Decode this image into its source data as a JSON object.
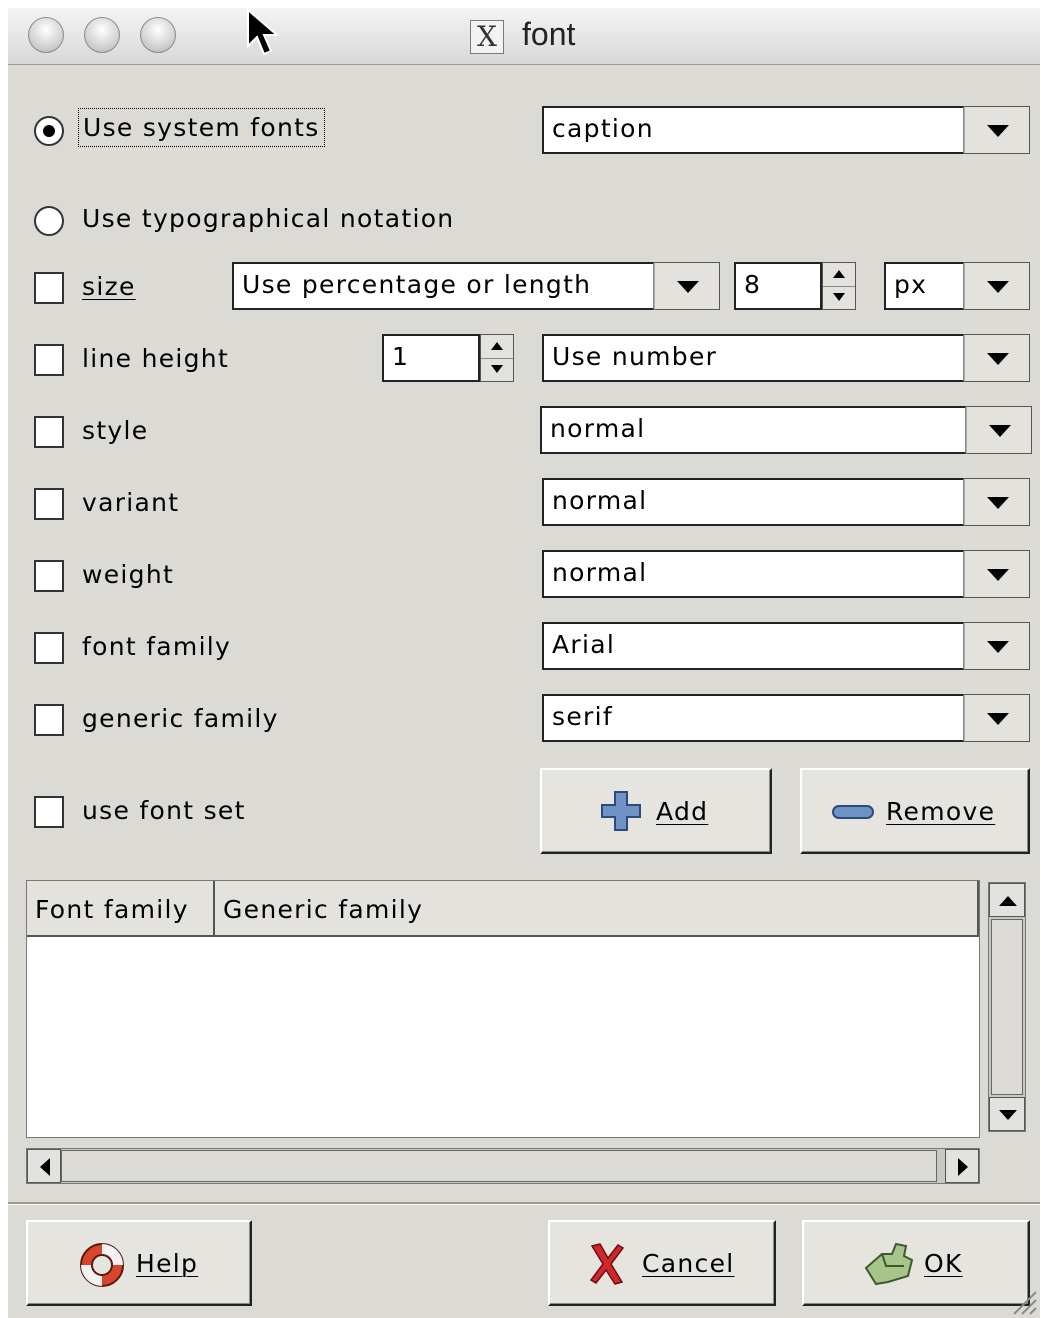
{
  "window": {
    "title": "font"
  },
  "system_fonts": {
    "label": "Use system fonts",
    "selected": true,
    "value": "caption"
  },
  "typographical": {
    "label": "Use typographical notation",
    "selected": false
  },
  "size": {
    "label": "size",
    "mode": "Use percentage or length",
    "value": "8",
    "unit": "px"
  },
  "line_height": {
    "label": "line height",
    "value": "1",
    "mode": "Use number"
  },
  "style": {
    "label": "style",
    "value": "normal"
  },
  "variant": {
    "label": "variant",
    "value": "normal"
  },
  "weight": {
    "label": "weight",
    "value": "normal"
  },
  "font_family": {
    "label": "font family",
    "value": "Arial"
  },
  "generic_family": {
    "label": "generic family",
    "value": "serif"
  },
  "font_set": {
    "label": "use font set",
    "add_label": "Add",
    "remove_label": "Remove"
  },
  "table": {
    "columns": [
      "Font family",
      "Generic family"
    ],
    "rows": []
  },
  "buttons": {
    "help": "Help",
    "cancel": "Cancel",
    "ok": "OK"
  },
  "icons": [
    "x11-icon",
    "plus-icon",
    "minus-icon",
    "lifebuoy-icon",
    "x-cancel-icon",
    "ok-hand-icon",
    "resize-grip-icon"
  ]
}
